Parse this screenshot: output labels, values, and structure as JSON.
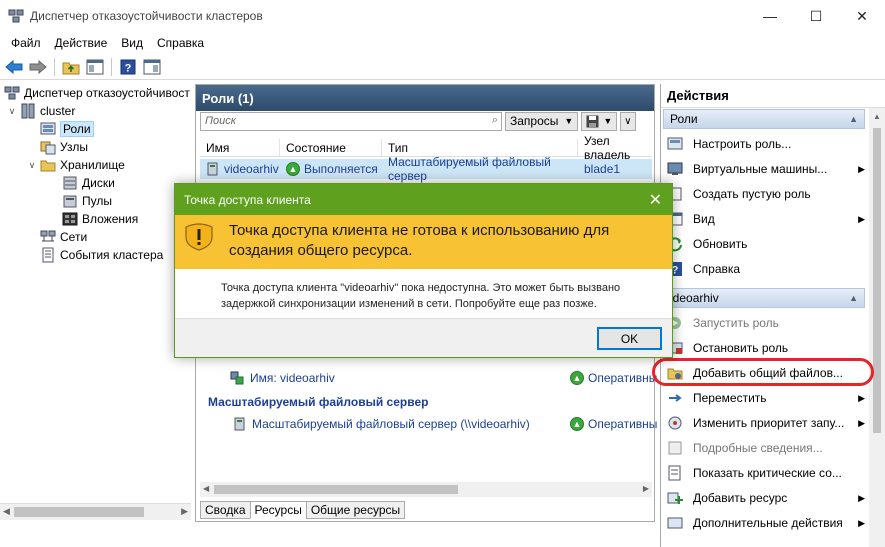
{
  "window": {
    "title": "Диспетчер отказоустойчивости кластеров"
  },
  "menu": [
    "Файл",
    "Действие",
    "Вид",
    "Справка"
  ],
  "tree": {
    "root": "Диспетчер отказоустойчивост",
    "cluster": "cluster",
    "roles": "Роли",
    "nodes": "Узлы",
    "storage": "Хранилище",
    "disks": "Диски",
    "pools": "Пулы",
    "enclosures": "Вложения",
    "networks": "Сети",
    "events": "События кластера"
  },
  "center": {
    "header": "Роли (1)",
    "search_placeholder": "Поиск",
    "queries_label": "Запросы",
    "columns": [
      "Имя",
      "Состояние",
      "Тип",
      "Узел владель"
    ],
    "row": {
      "name": "videoarhiv",
      "status": "Выполняется",
      "type": "Масштабируемый файловый сервер",
      "owner": "blade1"
    },
    "res_name_label": "Имя: videoarhiv",
    "res_status_1": "Оперативны",
    "section_sofs": "Масштабируемый файловый сервер",
    "res_sofs_label": "Масштабируемый файловый сервер (\\\\videoarhiv)",
    "res_status_2": "Оперативны",
    "tabs": [
      "Сводка",
      "Ресурсы",
      "Общие ресурсы"
    ]
  },
  "actions": {
    "title": "Действия",
    "group_roles": "Роли",
    "roles_items": [
      {
        "label": "Настроить роль...",
        "icon": "configure-role-icon",
        "arrow": false
      },
      {
        "label": "Виртуальные машины...",
        "icon": "vm-icon",
        "arrow": true
      },
      {
        "label": "Создать пустую роль",
        "icon": "empty-role-icon",
        "arrow": false
      },
      {
        "label": "Вид",
        "icon": "view-icon",
        "arrow": true
      },
      {
        "label": "Обновить",
        "icon": "refresh-icon",
        "arrow": false
      },
      {
        "label": "Справка",
        "icon": "help-icon",
        "arrow": false
      }
    ],
    "group_role": "ideoarhiv",
    "role_items": [
      {
        "label": "Запустить роль",
        "icon": "start-icon",
        "arrow": false,
        "disabled": true
      },
      {
        "label": "Остановить роль",
        "icon": "stop-icon",
        "arrow": false,
        "disabled": false
      },
      {
        "label": "Добавить общий файлов...",
        "icon": "add-share-icon",
        "arrow": false,
        "disabled": false
      },
      {
        "label": "Переместить",
        "icon": "move-icon",
        "arrow": true,
        "disabled": false
      },
      {
        "label": "Изменить приоритет запу...",
        "icon": "priority-icon",
        "arrow": true,
        "disabled": false
      },
      {
        "label": "Подробные сведения...",
        "icon": "details-icon",
        "arrow": false,
        "disabled": true
      },
      {
        "label": "Показать критические со...",
        "icon": "critical-events-icon",
        "arrow": false,
        "disabled": false
      },
      {
        "label": "Добавить ресурс",
        "icon": "add-resource-icon",
        "arrow": true,
        "disabled": false
      },
      {
        "label": "Дополнительные действия",
        "icon": "more-actions-icon",
        "arrow": true,
        "disabled": false
      }
    ]
  },
  "dialog": {
    "title": "Точка доступа клиента",
    "heading": "Точка доступа клиента не готова к использованию для создания общего ресурса.",
    "body": "Точка доступа клиента \"videoarhiv\" пока недоступна. Это может быть вызвано задержкой синхронизации изменений в сети. Попробуйте еще раз позже.",
    "ok_label": "OK"
  },
  "colors": {
    "dialog_title": "#5fa11e",
    "banner": "#f7c234",
    "highlight_ring": "#e8242a",
    "pane_header": "#2e4a6b"
  }
}
